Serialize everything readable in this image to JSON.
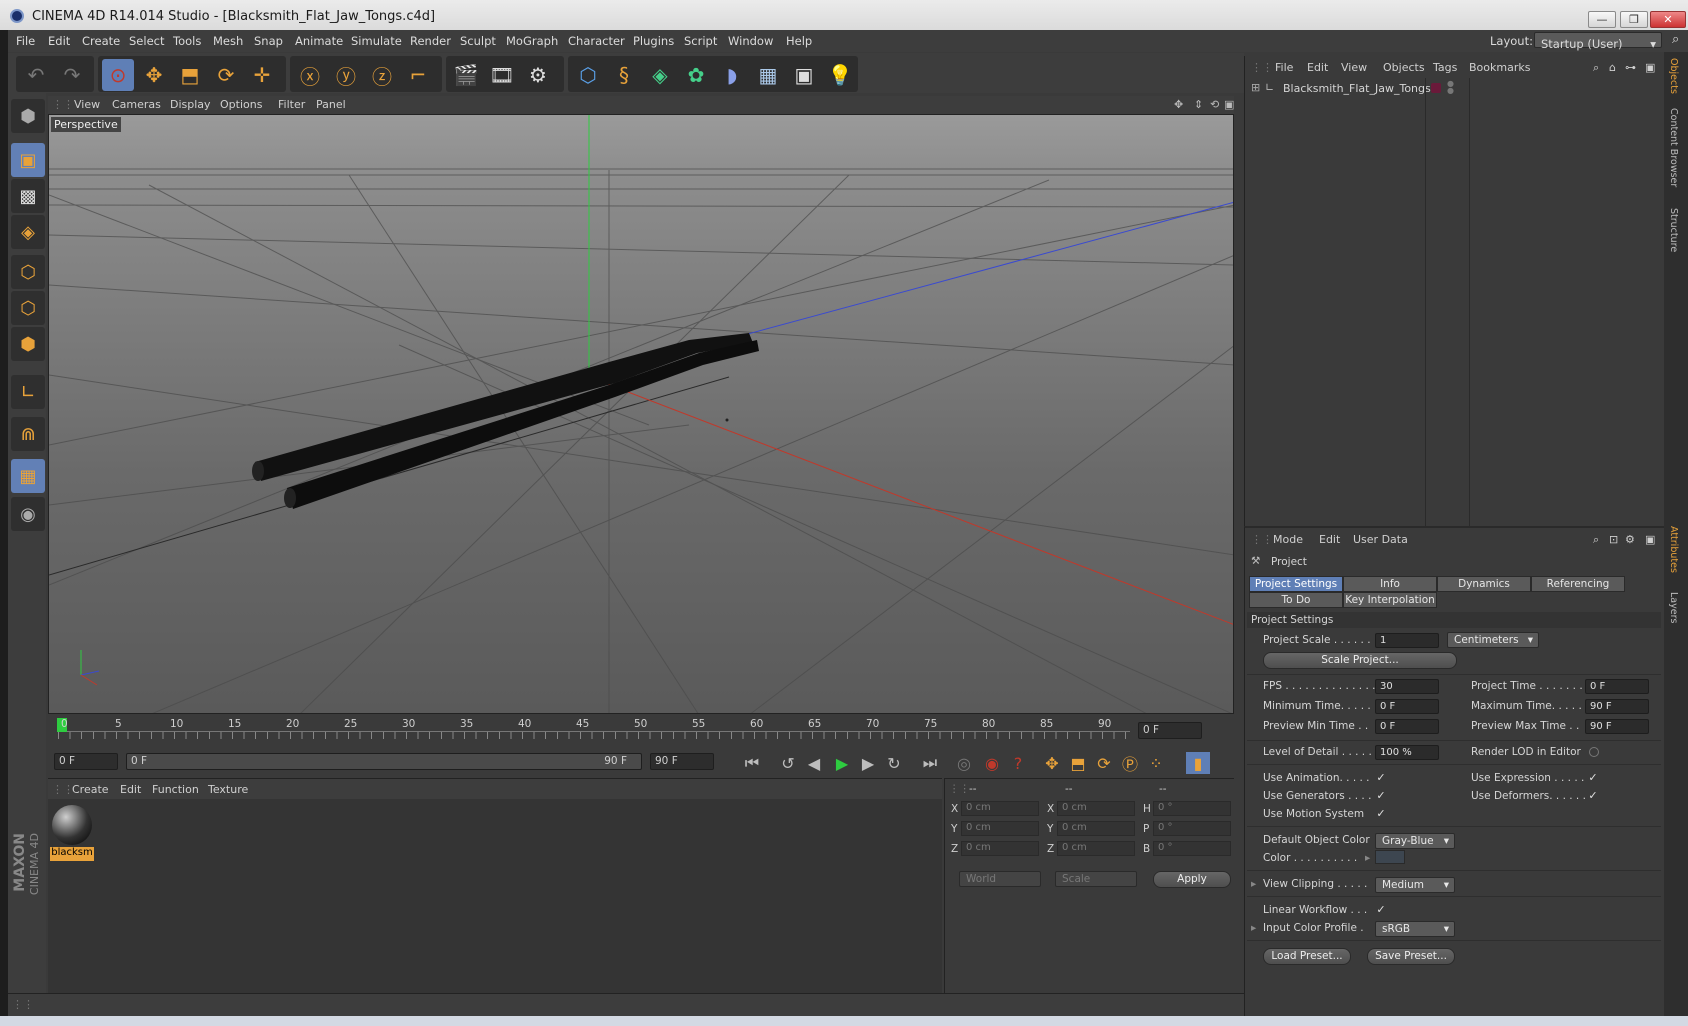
{
  "window": {
    "title": "CINEMA 4D R14.014 Studio - [Blacksmith_Flat_Jaw_Tongs.c4d]",
    "controls": {
      "minimize": "—",
      "restore": "❐",
      "close": "✕"
    }
  },
  "menubar": {
    "items": [
      "File",
      "Edit",
      "Create",
      "Select",
      "Tools",
      "Mesh",
      "Snap",
      "Animate",
      "Simulate",
      "Render",
      "Sculpt",
      "MoGraph",
      "Character",
      "Plugins",
      "Script",
      "Window",
      "Help"
    ],
    "layout_label": "Layout:",
    "layout_value": "Startup (User)"
  },
  "viewport": {
    "menu": [
      "View",
      "Cameras",
      "Display",
      "Options",
      "Filter",
      "Panel"
    ],
    "label": "Perspective"
  },
  "timeline": {
    "ticks": [
      "0",
      "5",
      "10",
      "15",
      "20",
      "25",
      "30",
      "35",
      "40",
      "45",
      "50",
      "55",
      "60",
      "65",
      "70",
      "75",
      "80",
      "85",
      "90"
    ],
    "current_frame": "0 F"
  },
  "playbar": {
    "start": "0 F",
    "range_start": "0 F",
    "range_end": "90 F",
    "end": "90 F"
  },
  "materials": {
    "menu": [
      "Create",
      "Edit",
      "Function",
      "Texture"
    ],
    "items": [
      {
        "label": "blacksm"
      }
    ]
  },
  "coordinates": {
    "headers": [
      "--",
      "--",
      "--"
    ],
    "rows": [
      {
        "l1": "X",
        "v1": "0 cm",
        "l2": "X",
        "v2": "0 cm",
        "l3": "H",
        "v3": "0 °"
      },
      {
        "l1": "Y",
        "v1": "0 cm",
        "l2": "Y",
        "v2": "0 cm",
        "l3": "P",
        "v3": "0 °"
      },
      {
        "l1": "Z",
        "v1": "0 cm",
        "l2": "Z",
        "v2": "0 cm",
        "l3": "B",
        "v3": "0 °"
      }
    ],
    "mode": "World",
    "scale": "Scale",
    "apply": "Apply"
  },
  "objects": {
    "menu": [
      "File",
      "Edit",
      "View",
      "Objects",
      "Tags",
      "Bookmarks"
    ],
    "items": [
      {
        "name": "Blacksmith_Flat_Jaw_Tongs"
      }
    ]
  },
  "attributes": {
    "menu": [
      "Mode",
      "Edit",
      "User Data"
    ],
    "header": "Project",
    "tabs": [
      "Project Settings",
      "Info",
      "Dynamics",
      "Referencing"
    ],
    "tabs2": [
      "To Do",
      "Key Interpolation"
    ],
    "section": "Project Settings",
    "project_scale_label": "Project Scale . . . . . .",
    "project_scale_value": "1",
    "project_scale_unit": "Centimeters",
    "scale_project_button": "Scale Project...",
    "fps_label": "FPS . . . . . . . . . . . . . .",
    "fps_value": "30",
    "project_time_label": "Project Time . . . . . . .",
    "project_time_value": "0 F",
    "min_time_label": "Minimum Time. . . . .",
    "min_time_value": "0 F",
    "max_time_label": "Maximum Time. . . . .",
    "max_time_value": "90 F",
    "prev_min_label": "Preview Min Time . .",
    "prev_min_value": "0 F",
    "prev_max_label": "Preview Max Time . .",
    "prev_max_value": "90 F",
    "lod_label": "Level of Detail . . . . .",
    "lod_value": "100 %",
    "render_lod_label": "Render LOD in Editor",
    "use_animation_label": "Use Animation. . . . .",
    "use_expression_label": "Use Expression . . . . .",
    "use_generators_label": "Use Generators . . . .",
    "use_deformers_label": "Use Deformers. . . . . .",
    "use_motion_label": "Use Motion System",
    "default_color_label": "Default Object Color",
    "default_color_value": "Gray-Blue",
    "color_label": "Color . . . . . . . . . .",
    "view_clipping_label": "View Clipping . . . . .",
    "view_clipping_value": "Medium",
    "linear_workflow_label": "Linear Workflow . . .",
    "input_profile_label": "Input Color Profile .",
    "input_profile_value": "sRGB",
    "load_preset": "Load Preset...",
    "save_preset": "Save Preset...",
    "check": "✓"
  },
  "right_tabs": [
    "Objects",
    "Content Browser",
    "Structure",
    "Attributes",
    "Layers"
  ],
  "logo": {
    "brand": "MAXON",
    "product": "CINEMA 4D"
  },
  "colors": {
    "accent": "#5f7fb6",
    "axis_x": "#c0392b",
    "axis_y": "#2ecc40",
    "axis_z": "#3a4ad0",
    "tool_orange": "#e8a23a"
  }
}
